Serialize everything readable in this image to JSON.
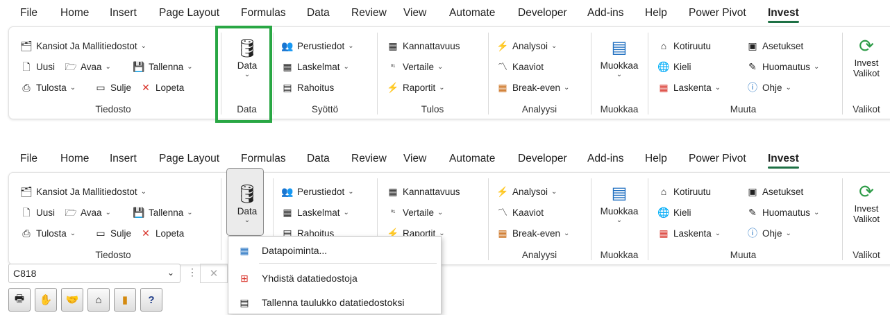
{
  "tabs": [
    "File",
    "Home",
    "Insert",
    "Page Layout",
    "Formulas",
    "Data",
    "Review",
    "View",
    "Automate",
    "Developer",
    "Add-ins",
    "Help",
    "Power Pivot",
    "Invest"
  ],
  "active_tab": "Invest",
  "groups": {
    "tiedosto": {
      "label": "Tiedosto",
      "kansiot": "Kansiot Ja Mallitiedostot",
      "uusi": "Uusi",
      "avaa": "Avaa",
      "tallenna": "Tallenna",
      "tulosta": "Tulosta",
      "sulje": "Sulje",
      "lopeta": "Lopeta"
    },
    "data": {
      "label": "Data",
      "button": "Data"
    },
    "syotto": {
      "label": "Syöttö",
      "perustiedot": "Perustiedot",
      "laskelmat": "Laskelmat",
      "rahoitus": "Rahoitus"
    },
    "tulos": {
      "label": "Tulos",
      "kannattavuus": "Kannattavuus",
      "vertaile": "Vertaile",
      "raportit": "Raportit"
    },
    "analyysi": {
      "label": "Analyysi",
      "analysoi": "Analysoi",
      "kaaviot": "Kaaviot",
      "breakeven": "Break-even"
    },
    "muokkaa": {
      "label": "Muokkaa",
      "button": "Muokkaa"
    },
    "muuta": {
      "label": "Muuta",
      "kotiruutu": "Kotiruutu",
      "kieli": "Kieli",
      "laskenta": "Laskenta",
      "asetukset": "Asetukset",
      "huomautus": "Huomautus",
      "ohje": "Ohje"
    },
    "valikot": {
      "label": "Valikot",
      "line1": "Invest",
      "line2": "Valikot"
    }
  },
  "dropdown": {
    "items": [
      "Datapoiminta...",
      "Yhdistä datatiedostoja",
      "Tallenna taulukko datatiedostoksi"
    ]
  },
  "formula_bar": {
    "name_box": "C818"
  },
  "colors": {
    "accent": "#1e7145",
    "highlight": "#29a744"
  }
}
